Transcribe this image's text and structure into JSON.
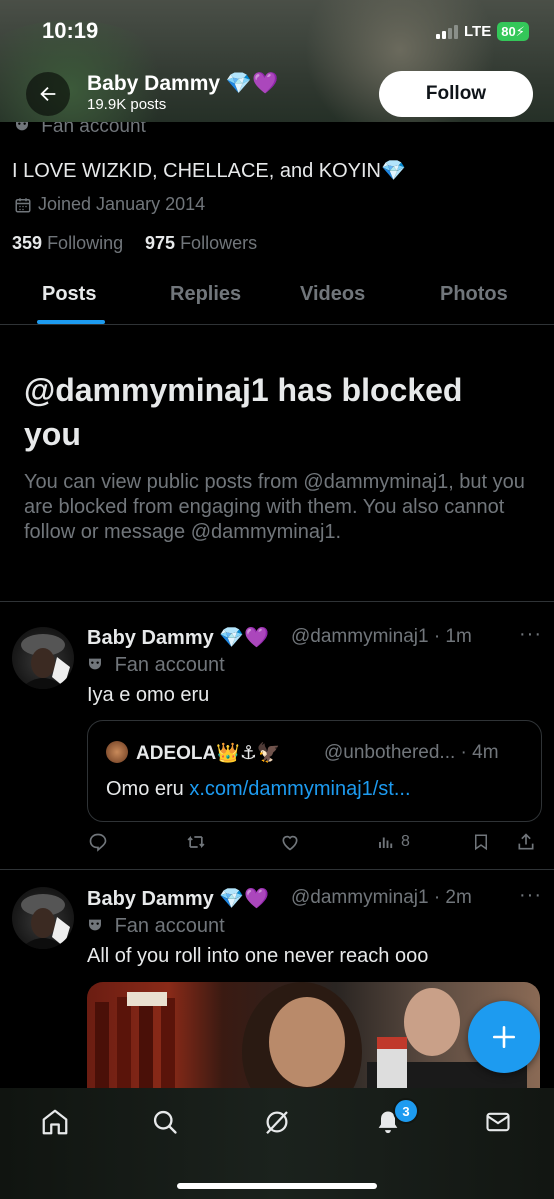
{
  "status_bar": {
    "time": "10:19",
    "network": "LTE",
    "battery": "80"
  },
  "header": {
    "name": "Baby Dammy",
    "emojis": "💎💜",
    "posts_count": "19.9K posts",
    "follow_label": "Follow"
  },
  "profile": {
    "fan_label": "Fan account",
    "bio": "I LOVE WIZKID, CHELLACE, and KOYIN💎",
    "joined": "Joined January 2014",
    "following_count": "359",
    "following_label": "Following",
    "followers_count": "975",
    "followers_label": "Followers"
  },
  "tabs": [
    "Posts",
    "Replies",
    "Videos",
    "Photos"
  ],
  "blocked": {
    "title": "@dammyminaj1 has blocked you",
    "description": "You can view public posts from @dammyminaj1, but you are blocked from engaging with them. You also cannot follow or message @dammyminaj1."
  },
  "posts": [
    {
      "name": "Baby Dammy",
      "emojis": "💎💜",
      "handle_time": "@dammyminaj1 · 1m",
      "fan_label": "Fan account",
      "text": "Iya e omo eru",
      "quote": {
        "name": "ADEOLA",
        "emojis": "👑⚓🦅",
        "handle_time": "@unbothered... · 4m",
        "text": "Omo eru",
        "link": "x.com/dammyminaj1/st..."
      },
      "views": "8"
    },
    {
      "name": "Baby Dammy",
      "emojis": "💎💜",
      "handle_time": "@dammyminaj1 · 2m",
      "fan_label": "Fan account",
      "text": "All of you roll into one never reach ooo"
    }
  ],
  "bottom_nav": {
    "notification_badge": "3"
  },
  "icons": [
    "back-arrow-icon",
    "mask-icon",
    "calendar-icon",
    "reply-icon",
    "retweet-icon",
    "like-icon",
    "views-icon",
    "bookmark-icon",
    "share-icon",
    "plus-icon",
    "home-icon",
    "search-icon",
    "grok-icon",
    "bell-icon",
    "mail-icon"
  ],
  "colors": {
    "accent": "#1d9bf0",
    "background": "#000000",
    "text": "#e7e9ea",
    "muted": "#71767b",
    "battery": "#34c759"
  }
}
